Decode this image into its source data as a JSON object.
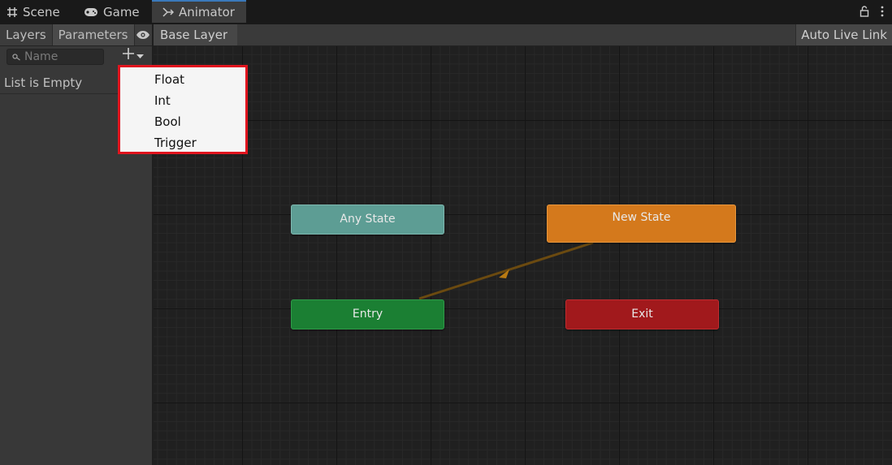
{
  "tabs": [
    {
      "label": "Scene",
      "icon": "grid-icon"
    },
    {
      "label": "Game",
      "icon": "gamepad-icon"
    },
    {
      "label": "Animator",
      "icon": "animator-icon",
      "active": true
    }
  ],
  "window_icons": [
    "lock-icon",
    "more-vertical-icon"
  ],
  "left_panel": {
    "tabs": [
      "Layers",
      "Parameters"
    ],
    "search_placeholder": "Name",
    "empty_text": "List is Empty"
  },
  "breadcrumb": "Base Layer",
  "auto_live_link": "Auto Live Link",
  "add_menu": {
    "items": [
      "Float",
      "Int",
      "Bool",
      "Trigger"
    ]
  },
  "nodes": {
    "any_state": "Any State",
    "new_state": "New State",
    "entry": "Entry",
    "exit": "Exit"
  },
  "colors": {
    "any_state": "#5d9d94",
    "new_state": "#d4791c",
    "entry": "#1b7f33",
    "exit": "#a1191c",
    "transition": "#6b4a10",
    "highlight": "#e0141e",
    "active_tab_accent": "#3a79bb"
  }
}
